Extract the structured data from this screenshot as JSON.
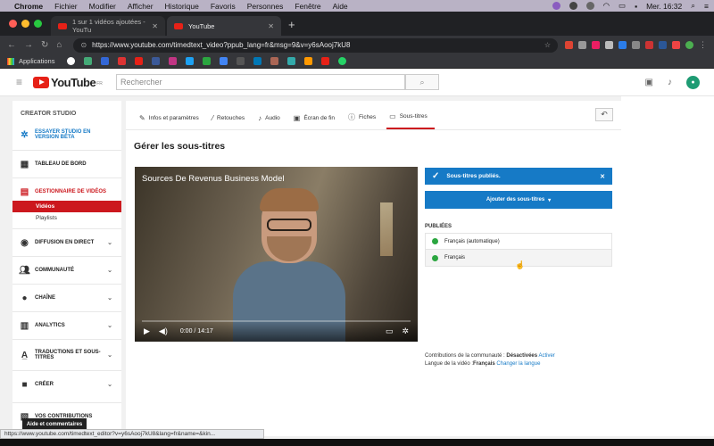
{
  "menubar": {
    "app": "Chrome",
    "items": [
      "Fichier",
      "Modifier",
      "Afficher",
      "Historique",
      "Favoris",
      "Personnes",
      "Fenêtre",
      "Aide"
    ],
    "clock": "Mer. 16:32"
  },
  "tabs": [
    {
      "title": "1 sur 1 vidéos ajoutées - YouTu",
      "active": false
    },
    {
      "title": "YouTube",
      "active": true
    }
  ],
  "address": {
    "url": "https://www.youtube.com/timedtext_video?ppub_lang=fr&msg=9&v=y6sAooj7kU8"
  },
  "bookmarks": {
    "apps_label": "Applications"
  },
  "youtube": {
    "logo_text": "YouTube",
    "logo_sup": "FR",
    "search_placeholder": "Rechercher"
  },
  "sidebar": {
    "header": "CREATOR STUDIO",
    "beta": "ESSAYER STUDIO EN VERSION BÊTA",
    "dashboard": "TABLEAU DE BORD",
    "video_manager": "GESTIONNAIRE DE VIDÉOS",
    "videos": "Vidéos",
    "playlists": "Playlists",
    "live": "DIFFUSION EN DIRECT",
    "community": "COMMUNAUTÉ",
    "channel": "CHAÎNE",
    "analytics": "ANALYTICS",
    "translations": "TRADUCTIONS ET SOUS-TITRES",
    "create": "CRÉER",
    "contributions": "VOS CONTRIBUTIONS",
    "help": "Aide et commentaires"
  },
  "subtabs": [
    {
      "label": "Infos et paramètres",
      "icon": "pencil-icon"
    },
    {
      "label": "Retouches",
      "icon": "wand-icon"
    },
    {
      "label": "Audio",
      "icon": "music-note-icon"
    },
    {
      "label": "Écran de fin",
      "icon": "end-screen-icon"
    },
    {
      "label": "Fiches",
      "icon": "info-card-icon"
    },
    {
      "label": "Sous-titres",
      "icon": "subtitles-icon",
      "active": true
    }
  ],
  "page": {
    "title": "Gérer les sous-titres"
  },
  "video": {
    "title": "Sources De Revenus Business Model",
    "time": "0:00 / 14:17"
  },
  "subtitles": {
    "banner": "Sous-titres publiés.",
    "add_button": "Ajouter des sous-titres",
    "published_label": "PUBLIÉES",
    "languages": [
      "Français (automatique)",
      "Français"
    ],
    "contributions_label": "Contributions de la communauté :",
    "contributions_value": "Désactivées",
    "contributions_action": "Activer",
    "video_lang_label": "Langue de la vidéo :",
    "video_lang_value": "Français",
    "video_lang_action": "Changer la langue"
  },
  "statusbar": {
    "url": "https://www.youtube.com/timedtext_editor?v=y6sAooj7kU8&lang=fr&name=&kin..."
  },
  "colors": {
    "youtube_red": "#cc181e",
    "youtube_blue": "#167ac6",
    "published_green": "#2ba640"
  }
}
